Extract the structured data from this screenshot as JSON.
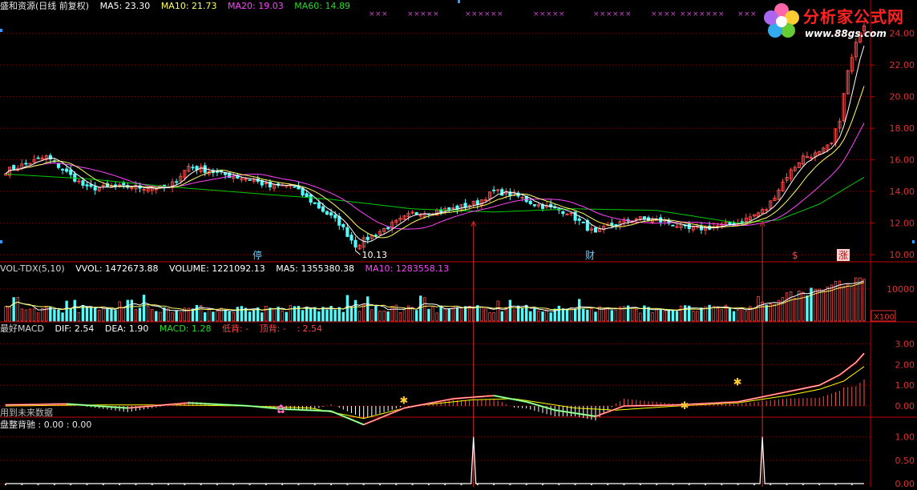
{
  "header": {
    "title": "盛和资源(日线 前复权)",
    "ma5": "MA5: 23.30",
    "ma10": "MA10: 21.73",
    "ma20": "MA20: 19.03",
    "ma60": "MA60: 14.89"
  },
  "watermark": {
    "name": "分析家公式网",
    "url": "www.88gs.com"
  },
  "colors": {
    "up": "#ff4d4d",
    "down": "#54fcfc",
    "ma5": "#ffffff",
    "ma10": "#ffff66",
    "ma20": "#ff44ff",
    "ma60": "#00cc00",
    "grid": "#8b0000",
    "axis": "#c00000",
    "dif": "#ffffff",
    "dea": "#ffff00",
    "purple_marks": "#cc44cc"
  },
  "volume_header": {
    "title": "VOL-TDX(5,10)",
    "vvol": "VVOL: 1472673.88",
    "volume": "VOLUME: 1221092.13",
    "ma5": "MA5: 1355380.38",
    "ma10": "MA10: 1283558.13"
  },
  "macd_header": {
    "title": "最好MACD",
    "dif": "DIF: 2.54",
    "dea": "DEA: 1.90",
    "macd": "MACD: 1.28",
    "low_div": "低背: -",
    "top_div": "顶背: -",
    "value": ": 2.54"
  },
  "note_future": "用到未来数据",
  "bottom_header": {
    "title": "盘整背驰 : 0.00 : 0.00"
  },
  "annotations": {
    "low_price": "10.13",
    "marker_stop": "停",
    "marker_finance": "财",
    "marker_s": "$",
    "marker_limit": "涨"
  },
  "volume_unit": "X100",
  "chart_data": [
    {
      "type": "candlestick",
      "panel": "price",
      "ylim": [
        9.6,
        25.2
      ],
      "ticks": [
        "24.00",
        "22.00",
        "20.00",
        "18.00",
        "16.00",
        "14.00",
        "12.00",
        "10.00"
      ],
      "tick_values": [
        24,
        22,
        20,
        18,
        16,
        14,
        12,
        10
      ],
      "grid": true,
      "bars": 212,
      "close_path": [
        [
          0,
          15.3
        ],
        [
          10,
          16.2
        ],
        [
          14,
          15.4
        ],
        [
          20,
          14.2
        ],
        [
          30,
          14.3
        ],
        [
          40,
          14.2
        ],
        [
          45,
          15.6
        ],
        [
          55,
          15.0
        ],
        [
          60,
          14.8
        ],
        [
          65,
          14.3
        ],
        [
          70,
          14.4
        ],
        [
          75,
          13.4
        ],
        [
          82,
          12.0
        ],
        [
          86,
          10.6
        ],
        [
          90,
          11.2
        ],
        [
          100,
          12.6
        ],
        [
          110,
          12.9
        ],
        [
          116,
          13.3
        ],
        [
          120,
          14.0
        ],
        [
          125,
          13.8
        ],
        [
          130,
          13.2
        ],
        [
          138,
          12.7
        ],
        [
          145,
          11.3
        ],
        [
          148,
          11.8
        ],
        [
          155,
          12.3
        ],
        [
          162,
          12.1
        ],
        [
          168,
          11.6
        ],
        [
          172,
          11.7
        ],
        [
          180,
          12.0
        ],
        [
          187,
          12.9
        ],
        [
          192,
          15.0
        ],
        [
          196,
          16.2
        ],
        [
          200,
          16.4
        ],
        [
          203,
          17.0
        ],
        [
          205,
          18.6
        ],
        [
          207,
          21.6
        ],
        [
          208,
          22.4
        ],
        [
          210,
          24.2
        ],
        [
          211,
          24.6
        ]
      ],
      "ma60_path": [
        [
          0,
          15.1
        ],
        [
          20,
          14.8
        ],
        [
          40,
          14.3
        ],
        [
          60,
          13.9
        ],
        [
          80,
          13.5
        ],
        [
          100,
          12.9
        ],
        [
          120,
          12.7
        ],
        [
          140,
          12.9
        ],
        [
          160,
          12.8
        ],
        [
          180,
          12.0
        ],
        [
          190,
          12.2
        ],
        [
          200,
          13.2
        ],
        [
          211,
          14.9
        ]
      ]
    },
    {
      "type": "bar",
      "panel": "volume",
      "ylim": [
        0,
        14000
      ],
      "ticks": [
        "10000"
      ],
      "tick_values": [
        10000
      ],
      "unit": "X100"
    },
    {
      "type": "line",
      "panel": "macd",
      "ylim": [
        -0.5,
        3.4
      ],
      "ticks": [
        "3.00",
        "2.00",
        "1.00",
        "0.00"
      ],
      "tick_values": [
        3,
        2,
        1,
        0
      ],
      "dif_path": [
        [
          0,
          0.05
        ],
        [
          15,
          0.1
        ],
        [
          30,
          -0.1
        ],
        [
          45,
          0.15
        ],
        [
          60,
          0.0
        ],
        [
          68,
          -0.15
        ],
        [
          80,
          -0.25
        ],
        [
          88,
          -0.9
        ],
        [
          98,
          -0.1
        ],
        [
          110,
          0.35
        ],
        [
          120,
          0.5
        ],
        [
          128,
          0.2
        ],
        [
          135,
          -0.2
        ],
        [
          145,
          -0.5
        ],
        [
          152,
          0.0
        ],
        [
          165,
          0.05
        ],
        [
          180,
          0.2
        ],
        [
          190,
          0.6
        ],
        [
          200,
          1.0
        ],
        [
          205,
          1.5
        ],
        [
          209,
          2.1
        ],
        [
          211,
          2.54
        ]
      ],
      "dea_path": [
        [
          0,
          0.0
        ],
        [
          20,
          0.05
        ],
        [
          40,
          0.05
        ],
        [
          60,
          0.0
        ],
        [
          75,
          -0.1
        ],
        [
          88,
          -0.6
        ],
        [
          100,
          0.0
        ],
        [
          115,
          0.3
        ],
        [
          125,
          0.35
        ],
        [
          140,
          -0.1
        ],
        [
          150,
          -0.2
        ],
        [
          165,
          0.0
        ],
        [
          180,
          0.15
        ],
        [
          192,
          0.5
        ],
        [
          200,
          0.8
        ],
        [
          206,
          1.2
        ],
        [
          211,
          1.9
        ]
      ]
    },
    {
      "type": "line",
      "panel": "consolidation-divergence",
      "ylim": [
        0,
        1.15
      ],
      "ticks": [
        "1.00",
        "0.50",
        "0.00"
      ],
      "tick_values": [
        1,
        0.5,
        0
      ],
      "spikes_at_bar": [
        115,
        186
      ]
    }
  ]
}
